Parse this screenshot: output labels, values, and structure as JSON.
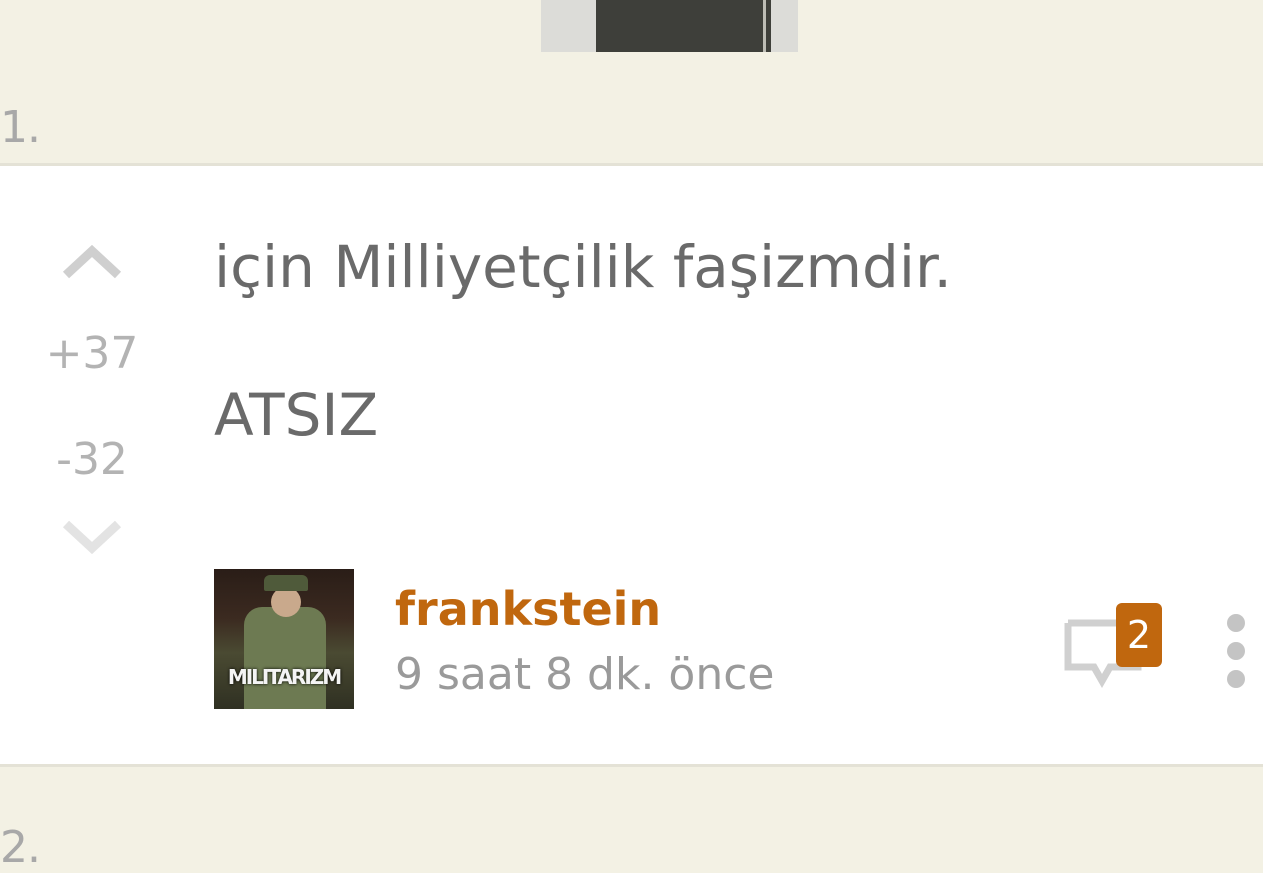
{
  "entries": {
    "prev_number": "1.",
    "next_number": "2."
  },
  "entry": {
    "lines": [
      "için Milliyetçilik faşizmdir.",
      "ATSIZ"
    ],
    "upvotes": "+37",
    "downvotes": "-32",
    "author": "frankstein",
    "time": "9 saat 8 dk. önce",
    "comment_count": "2",
    "avatar_caption": "MILITARIZM"
  },
  "colors": {
    "accent": "#c0670e",
    "page_bg": "#f3f1e4",
    "card_bg": "#ffffff",
    "text": "#6a6a6a",
    "muted": "#b3b3b3"
  },
  "icons": {
    "vote_up": "chevron-up-icon",
    "vote_down": "chevron-down-icon",
    "comment": "comment-bubble-icon",
    "more": "more-vertical-icon"
  }
}
